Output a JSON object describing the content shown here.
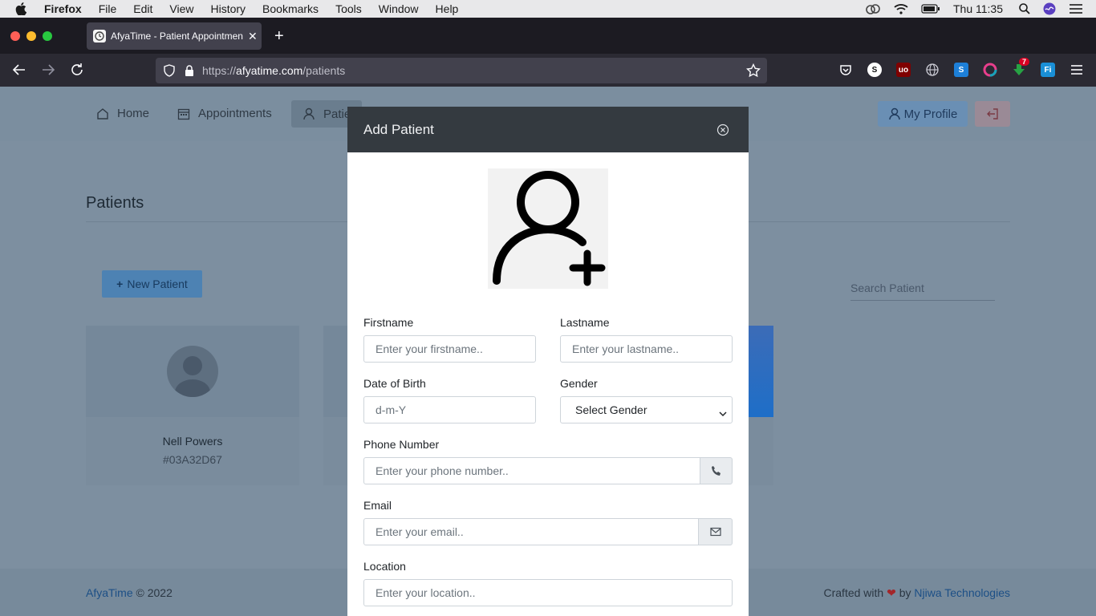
{
  "menubar": {
    "app": "Firefox",
    "items": [
      "File",
      "Edit",
      "View",
      "History",
      "Bookmarks",
      "Tools",
      "Window",
      "Help"
    ],
    "clock": "Thu 11:35"
  },
  "browser": {
    "tab_title": "AfyaTime - Patient Appointment",
    "url_protocol": "https://",
    "url_host": "afyatime.com",
    "url_path": "/patients",
    "ext_badge": "7"
  },
  "nav": {
    "home": "Home",
    "appointments": "Appointments",
    "patients": "Patie",
    "my_profile": "My Profile"
  },
  "main": {
    "heading": "Patients",
    "new_patient": "New Patient",
    "search_placeholder": "Search Patient",
    "cards": [
      {
        "name": "Nell Powers",
        "id": "#03A32D67"
      }
    ]
  },
  "footer": {
    "brand": "AfyaTime",
    "copyright": "© 2022",
    "crafted": "Crafted with",
    "by": "by",
    "company": "Njiwa Technologies"
  },
  "modal": {
    "title": "Add Patient",
    "firstname_label": "Firstname",
    "firstname_placeholder": "Enter your firstname..",
    "lastname_label": "Lastname",
    "lastname_placeholder": "Enter your lastname..",
    "dob_label": "Date of Birth",
    "dob_placeholder": "d-m-Y",
    "gender_label": "Gender",
    "gender_value": "Select Gender",
    "phone_label": "Phone Number",
    "phone_placeholder": "Enter your phone number..",
    "email_label": "Email",
    "email_placeholder": "Enter your email..",
    "location_label": "Location",
    "location_placeholder": "Enter your location.."
  },
  "colors": {
    "modal_header": "#343a40",
    "link": "#1c4f86",
    "overlay_page": "#7d8fa0"
  }
}
